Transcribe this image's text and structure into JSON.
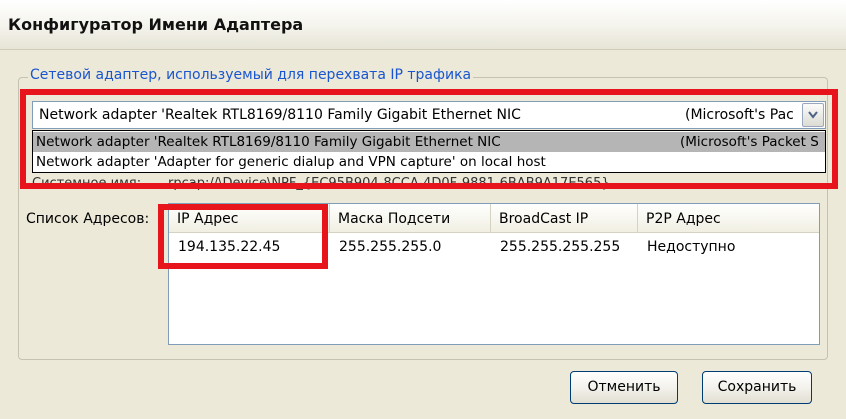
{
  "window": {
    "title": "Конфигуратор Имени Адаптера"
  },
  "adapter_group": {
    "legend": "Сетевой адаптер, используемый для перехвата IP трафика",
    "combo": {
      "selected_text": "Network adapter 'Realtek RTL8169/8110 Family Gigabit Ethernet NIC",
      "selected_suffix": "(Microsoft's Pac"
    },
    "options": [
      {
        "text": "Network adapter 'Realtek RTL8169/8110 Family Gigabit Ethernet NIC",
        "suffix": "(Microsoft's Packet S",
        "selected": true
      },
      {
        "text": "Network adapter 'Adapter for generic dialup and VPN capture' on local host",
        "suffix": "",
        "selected": false
      }
    ],
    "system_name_label": "Системное имя:",
    "system_name_value": "rpcap://\\Device\\NPF_{EC95B904-8CCA-4D0F-9881-6BAB9A17E565}"
  },
  "address_list": {
    "label": "Список Адресов:",
    "columns": [
      "IP Адрес",
      "Маска Подсети",
      "BroadCast IP",
      "P2P Адрес"
    ],
    "rows": [
      [
        "194.135.22.45",
        "255.255.255.0",
        "255.255.255.255",
        "Недоступно"
      ]
    ]
  },
  "buttons": {
    "cancel": "Отменить",
    "save": "Сохранить"
  },
  "colors": {
    "highlight": "#e8141c",
    "legend": "#1a55d0",
    "face": "#ece9d8"
  }
}
